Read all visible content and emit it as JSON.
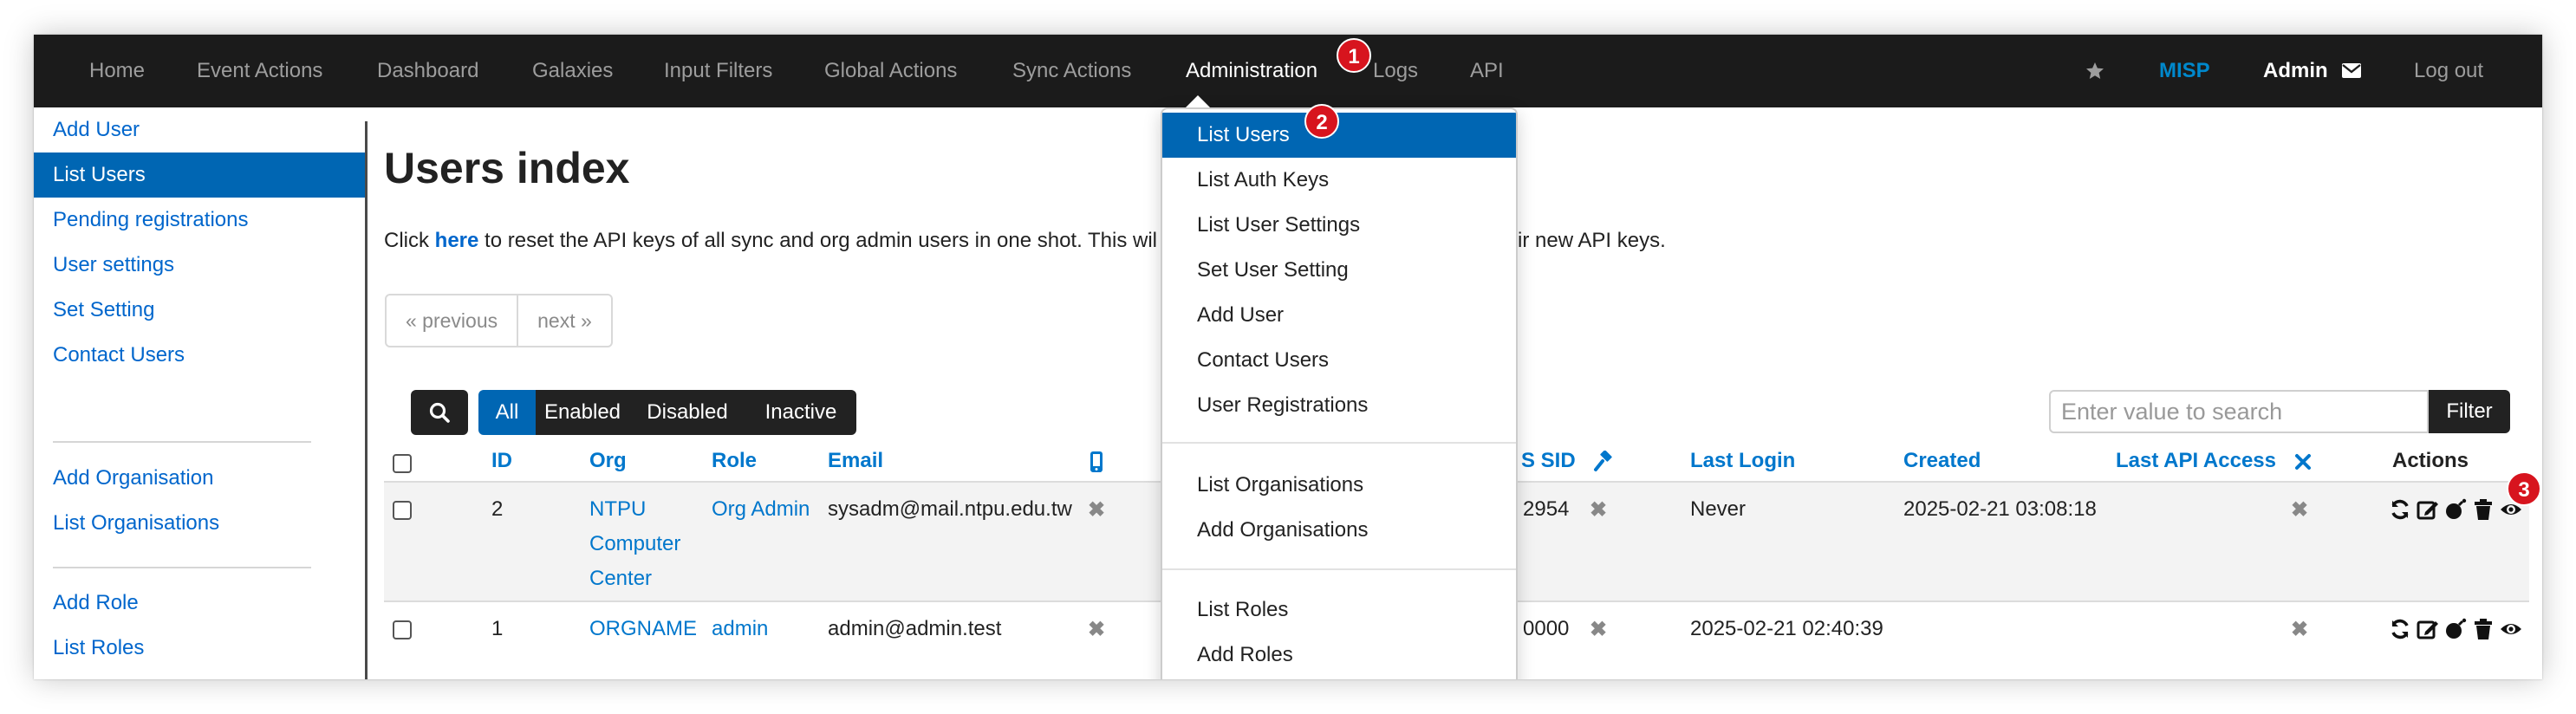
{
  "nav": {
    "items": [
      "Home",
      "Event Actions",
      "Dashboard",
      "Galaxies",
      "Input Filters",
      "Global Actions",
      "Sync Actions",
      "Administration",
      "Logs",
      "API"
    ],
    "brand": "MISP",
    "user": "Admin",
    "logout": "Log out"
  },
  "badges": [
    "1",
    "2",
    "3"
  ],
  "sidebar": {
    "items": [
      "Add User",
      "List Users",
      "Pending registrations",
      "User settings",
      "Set Setting",
      "Contact Users",
      "Add Organisation",
      "List Organisations",
      "Add Role",
      "List Roles"
    ],
    "active": "List Users"
  },
  "page": {
    "title": "Users index",
    "info_before": "Click ",
    "info_link": "here",
    "info_after": " to reset the API keys of all sync and org admin users in one shot. This wil",
    "info_tail": "ir new API keys."
  },
  "pagination": {
    "previous": "« previous",
    "next": "next »"
  },
  "filter_tabs": [
    "All",
    "Enabled",
    "Disabled",
    "Inactive"
  ],
  "search": {
    "placeholder": "Enter value to search",
    "button": "Filter"
  },
  "table": {
    "headers": {
      "id": "ID",
      "org": "Org",
      "role": "Role",
      "email": "Email",
      "sid": "S SID",
      "last_login": "Last Login",
      "created": "Created",
      "last_api": "Last API Access",
      "actions": "Actions"
    },
    "rows": [
      {
        "id": "2",
        "org_lines": [
          "NTPU",
          "Computer",
          "Center"
        ],
        "role": "Org Admin",
        "email": "sysadm@mail.ntpu.edu.tw",
        "sid": "2954",
        "last_login": "Never",
        "created": "2025-02-21 03:08:18",
        "last_api": ""
      },
      {
        "id": "1",
        "org_lines": [
          "ORGNAME"
        ],
        "role": "admin",
        "email": "admin@admin.test",
        "sid": "0000",
        "last_login": "2025-02-21 02:40:39",
        "created": "",
        "last_api": ""
      }
    ]
  },
  "dropdown": {
    "items": [
      "List Users",
      "List Auth Keys",
      "List User Settings",
      "Set User Setting",
      "Add User",
      "Contact Users",
      "User Registrations",
      "List Organisations",
      "Add Organisations",
      "List Roles",
      "Add Roles"
    ],
    "active": "List Users"
  },
  "colors": {
    "navbar": "#1b1b1b",
    "accent": "#0066b3",
    "link": "#0077cc",
    "badge": "#d7141e"
  }
}
